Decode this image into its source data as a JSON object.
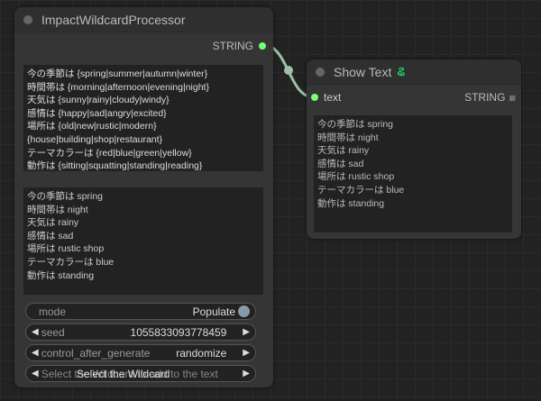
{
  "wildcard_node": {
    "title": "ImpactWildcardProcessor",
    "output_label": "STRING",
    "template_lines": [
      "今の季節は {spring|summer|autumn|winter}",
      "時間帯は {morning|afternoon|evening|night}",
      "天気は {sunny|rainy|cloudy|windy}",
      "感情は {happy|sad|angry|excited}",
      "場所は {old|new|rustic|modern}",
      "{house|building|shop|restaurant}",
      "テーマカラーは {red|blue|green|yellow}",
      "動作は {sitting|squatting|standing|reading}"
    ],
    "result_lines": [
      "今の季節は spring",
      "時間帯は night",
      "天気は rainy",
      "感情は sad",
      "場所は rustic shop",
      "テーマカラーは blue",
      "動作は standing"
    ],
    "widgets": {
      "mode_label": "mode",
      "mode_value": "Populate",
      "seed_label": "seed",
      "seed_value": "1055833093778459",
      "control_label": "control_after_generate",
      "control_value": "randomize",
      "wildcard_label": "Select the Wildcard to add to the text",
      "wildcard_overlay": "Select the Wildcard"
    }
  },
  "show_text_node": {
    "title": "Show Text",
    "input_label": "text",
    "output_label": "STRING",
    "lines": [
      "今の季節は spring",
      "時間帯は night",
      "天気は rainy",
      "感情は sad",
      "場所は rustic shop",
      "テーマカラーは blue",
      "動作は standing"
    ]
  },
  "colors": {
    "socket": "#77ff77",
    "link": "#a8c8b0",
    "badge": "#22cc66"
  }
}
